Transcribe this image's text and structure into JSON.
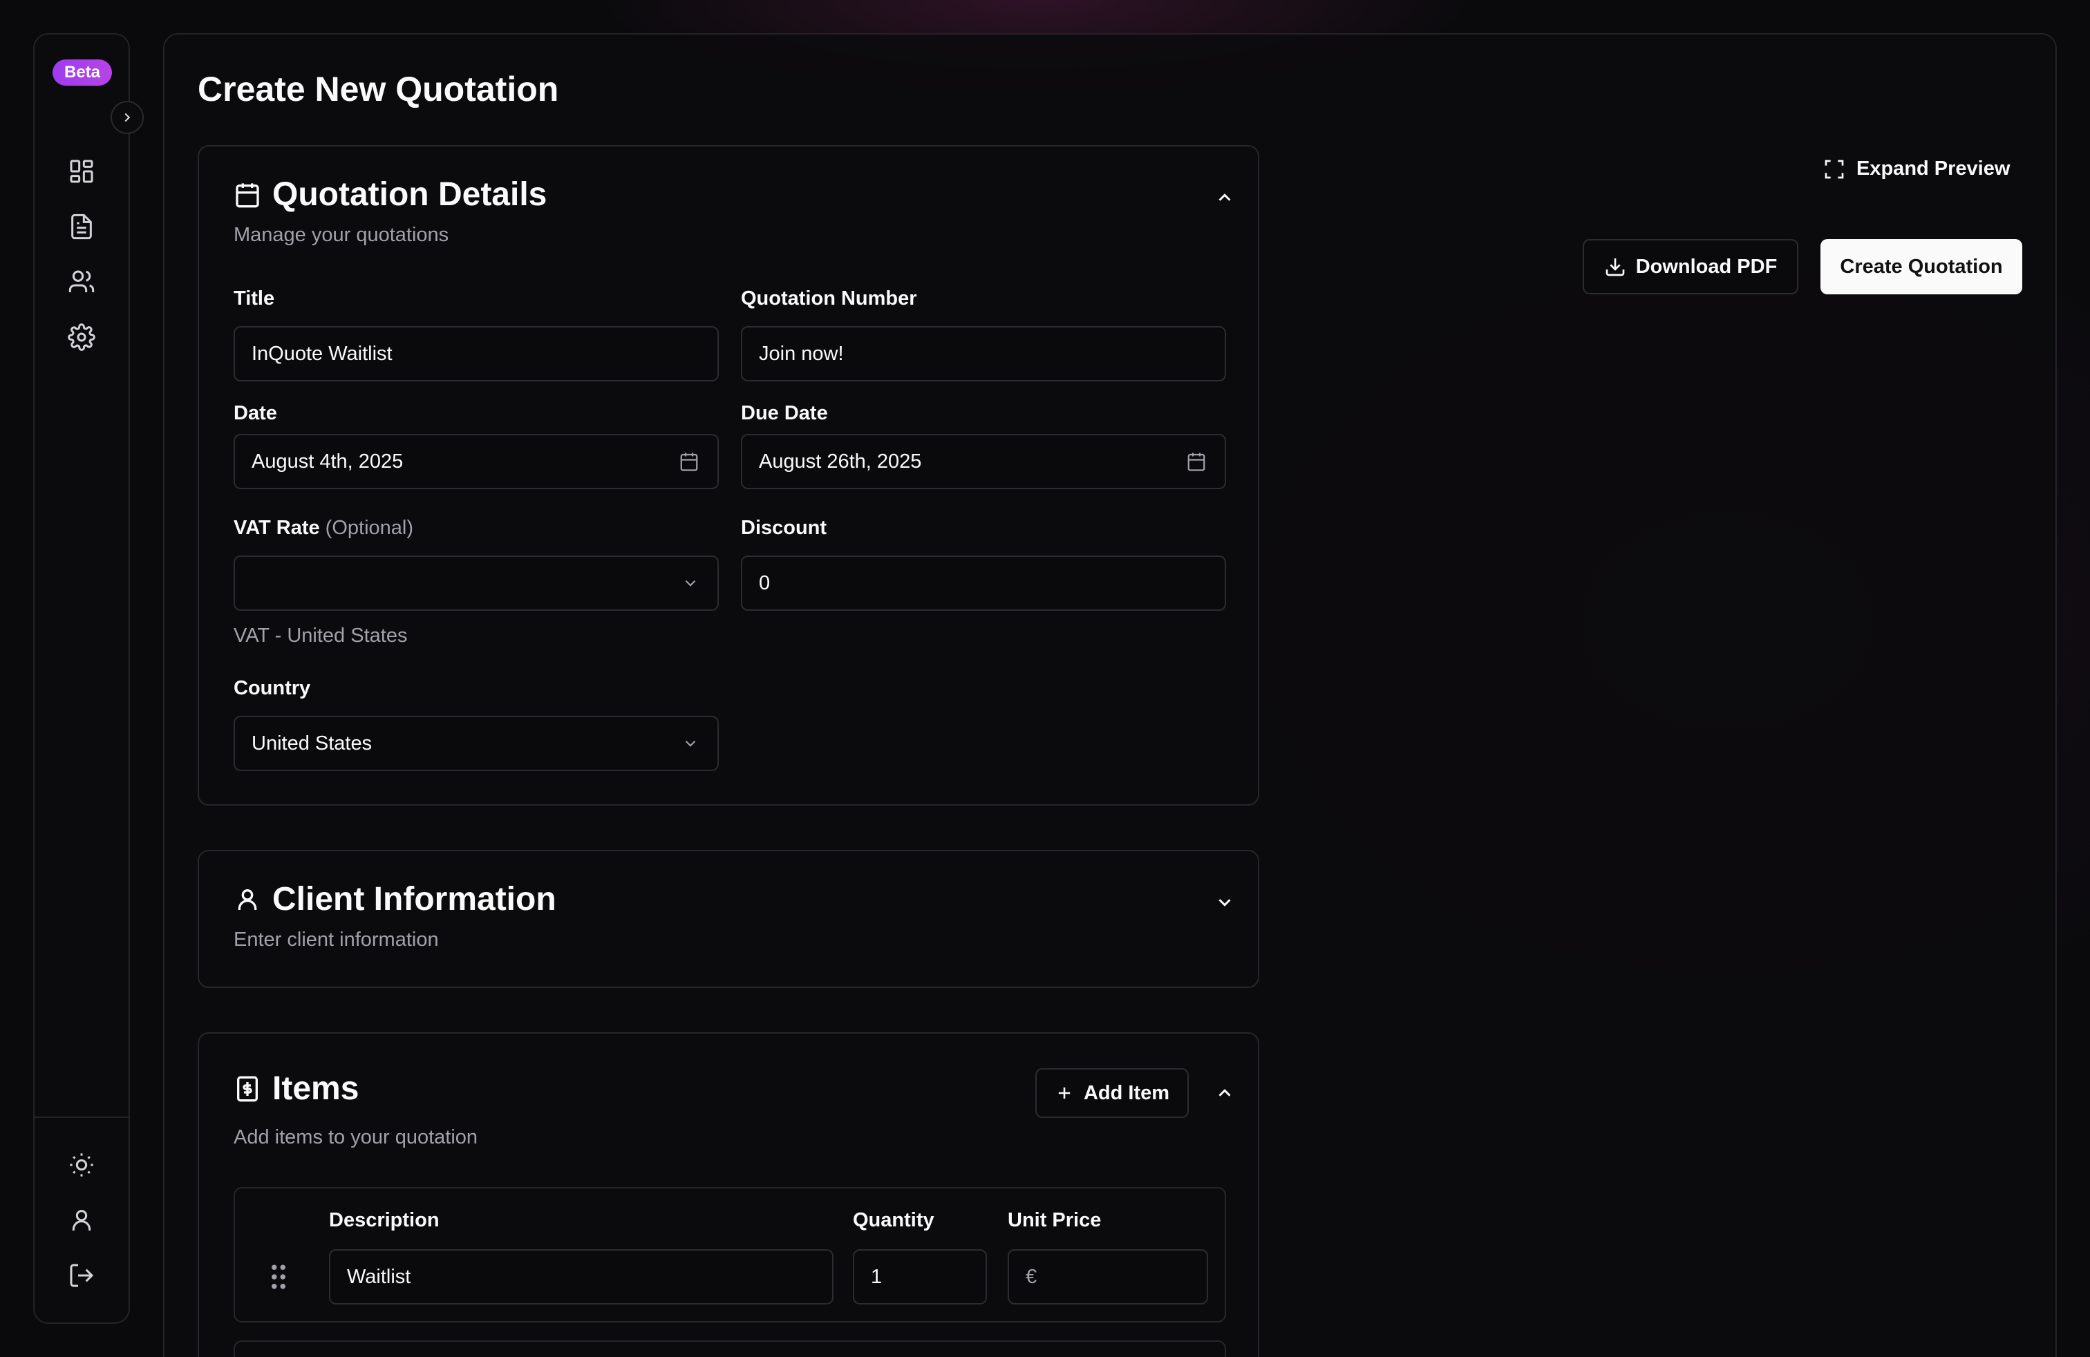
{
  "sidebar": {
    "badge": "Beta",
    "nav": [
      "dashboard-icon",
      "document-icon",
      "users-icon",
      "settings-icon"
    ],
    "bottom": [
      "sun-icon",
      "user-icon",
      "logout-icon"
    ]
  },
  "page": {
    "title": "Create New Quotation"
  },
  "actions": {
    "expand_preview": "Expand Preview",
    "download_pdf": "Download PDF",
    "create_quotation": "Create Quotation"
  },
  "details": {
    "title": "Quotation Details",
    "subtitle": "Manage your quotations",
    "fields": {
      "title_label": "Title",
      "title_value": "InQuote Waitlist",
      "number_label": "Quotation Number",
      "number_value": "Join now!",
      "date_label": "Date",
      "date_value": "August 4th, 2025",
      "due_label": "Due Date",
      "due_value": "August 26th, 2025",
      "vat_label": "VAT Rate",
      "vat_optional": "(Optional)",
      "vat_value": "",
      "vat_helper": "VAT - United States",
      "discount_label": "Discount",
      "discount_value": "0",
      "country_label": "Country",
      "country_value": "United States"
    }
  },
  "client": {
    "title": "Client Information",
    "subtitle": "Enter client information"
  },
  "items": {
    "title": "Items",
    "subtitle": "Add items to your quotation",
    "add_label": "Add Item",
    "headers": {
      "description": "Description",
      "quantity": "Quantity",
      "unit_price": "Unit Price"
    },
    "rows": [
      {
        "description": "Waitlist",
        "quantity": "1",
        "currency": "€",
        "unit_price": ""
      }
    ]
  },
  "colors": {
    "accent": "#a33ff0",
    "background": "#0a0a0c",
    "border": "#27272b"
  }
}
